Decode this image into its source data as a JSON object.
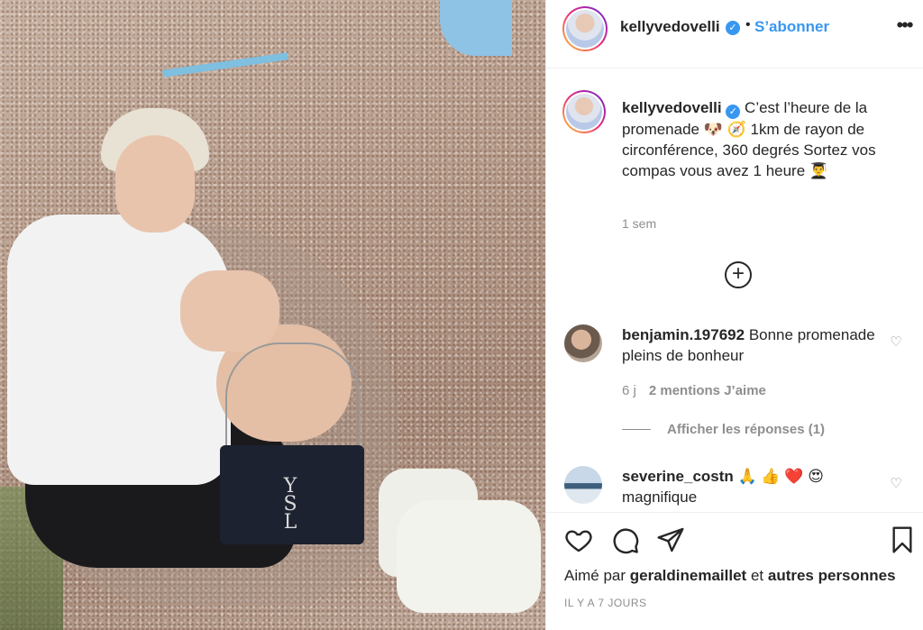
{
  "post": {
    "author": "kellyvedovelli",
    "follow_label": "S’abonner",
    "separator": "•",
    "more_label": "•••",
    "verified_glyph": "✓"
  },
  "caption": {
    "username": "kellyvedovelli",
    "text": "C’est l’heure de la promenade 🐶 🧭 1km de rayon de circonférence, 360 degrés Sortez vos compas vous avez 1 heure 👨‍🎓",
    "time": "1 sem"
  },
  "load_more_glyph": "+",
  "comments": [
    {
      "username": "benjamin.197692",
      "text": "Bonne promenade pleins de bonheur",
      "age": "6 j",
      "likes": "2 mentions J’aime",
      "replies": "Afficher les réponses (1)"
    },
    {
      "username": "severine_costn",
      "text": "🙏 👍 ❤️ 😍 magnifique"
    }
  ],
  "footer": {
    "liked_prefix": "Aimé par",
    "liked_user": "geraldinemaillet",
    "liked_and": "et",
    "liked_others": "autres personnes",
    "date": "IL Y A 7 JOURS"
  },
  "icons": {
    "heart_outline": "♡",
    "verified": "verified-icon"
  },
  "colors": {
    "accent_blue": "#3897f0",
    "text": "#262626",
    "muted": "#8e8e8e",
    "border": "#efefef"
  }
}
